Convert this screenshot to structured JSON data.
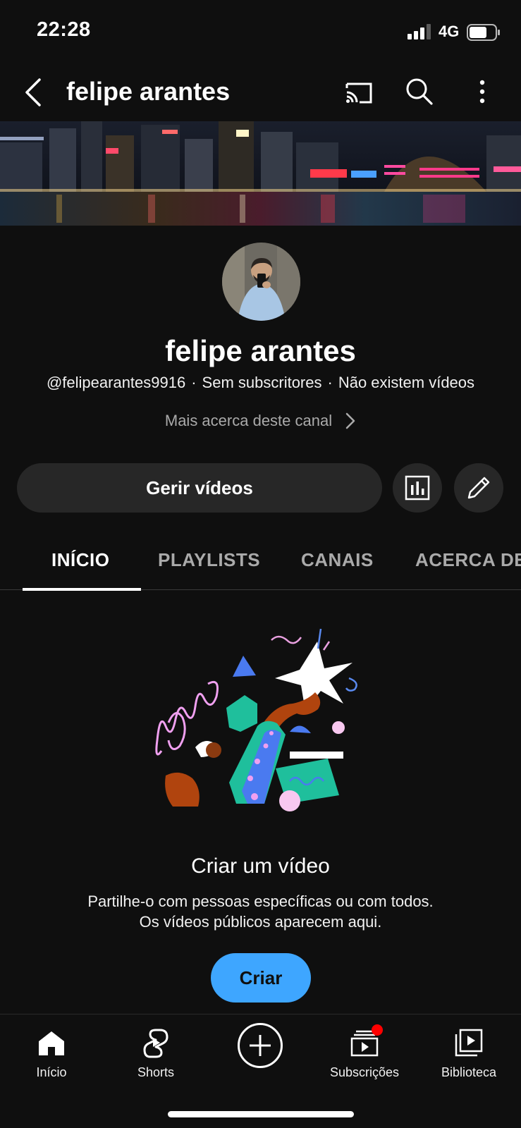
{
  "status": {
    "time": "22:28",
    "network": "4G"
  },
  "header": {
    "title": "felipe arantes"
  },
  "channel": {
    "name": "felipe arantes",
    "handle": "@felipearantes9916",
    "subscribers": "Sem subscritores",
    "videos": "Não existem vídeos",
    "more_about": "Mais acerca deste canal"
  },
  "actions": {
    "manage_label": "Gerir vídeos"
  },
  "tabs": [
    {
      "label": "INÍCIO",
      "active": true
    },
    {
      "label": "PLAYLISTS",
      "active": false
    },
    {
      "label": "CANAIS",
      "active": false
    },
    {
      "label": "ACERCA DE",
      "active": false
    }
  ],
  "empty_state": {
    "title": "Criar um vídeo",
    "line1": "Partilhe-o com pessoas específicas ou com todos.",
    "line2": "Os vídeos públicos aparecem aqui.",
    "button": "Criar"
  },
  "bottom_nav": [
    {
      "label": "Início",
      "icon": "home-icon"
    },
    {
      "label": "Shorts",
      "icon": "shorts-icon"
    },
    {
      "label": "",
      "icon": "add-icon"
    },
    {
      "label": "Subscrições",
      "icon": "subscriptions-icon"
    },
    {
      "label": "Biblioteca",
      "icon": "library-icon"
    }
  ],
  "colors": {
    "background": "#0f0f0f",
    "surface": "#272727",
    "accent": "#3ea6ff",
    "notification": "#ff0000"
  }
}
